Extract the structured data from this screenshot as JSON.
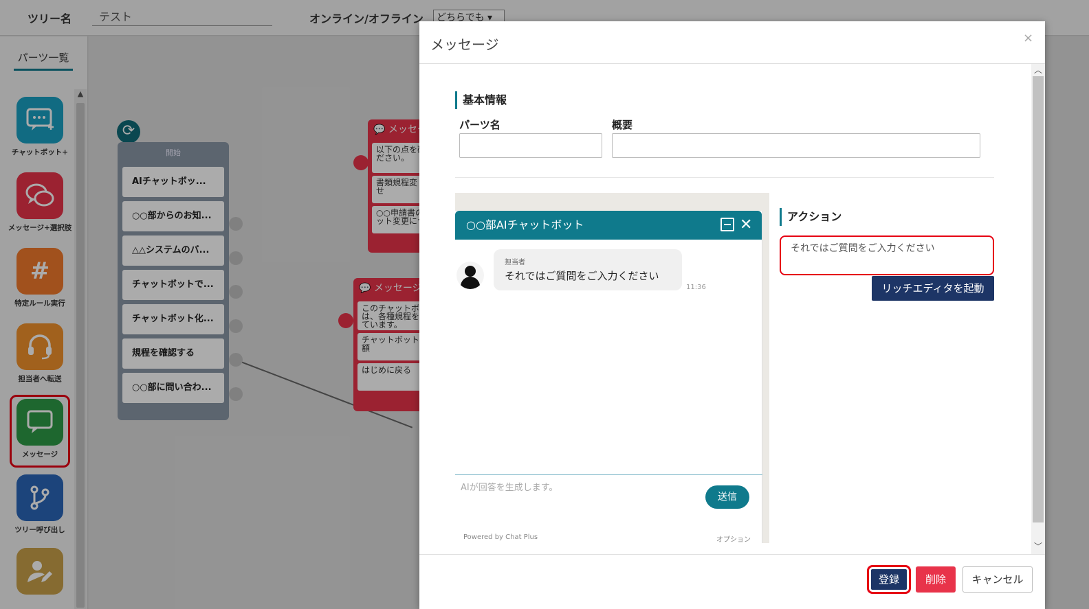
{
  "header": {
    "tree_label": "ツリー名",
    "tree_name_value": "テスト",
    "online_label": "オンライン/オフライン",
    "online_select_value": "どちらでも"
  },
  "sidebar": {
    "parts_tab": "パーツ一覧",
    "parts": [
      {
        "label": "チャットボット+",
        "icon": "chatbot-plus-icon",
        "color": "#1aa0c2"
      },
      {
        "label": "メッセージ+選択肢",
        "icon": "message-choice-icon",
        "color": "#e8334a"
      },
      {
        "label": "特定ルール実行",
        "icon": "hash-icon",
        "color": "#f07a2c"
      },
      {
        "label": "担当者へ転送",
        "icon": "headset-icon",
        "color": "#f0912c"
      },
      {
        "label": "メッセージ",
        "icon": "message-icon",
        "color": "#2e9a46"
      },
      {
        "label": "ツリー呼び出し",
        "icon": "branch-icon",
        "color": "#2a66b8"
      },
      {
        "label": "",
        "icon": "user-edit-icon",
        "color": "#c8a04a"
      }
    ]
  },
  "canvas": {
    "start_node": {
      "title": "開始",
      "items": [
        "AIチャットボッ...",
        "○○部からのお知...",
        "△△システムのバ...",
        "チャットボットで...",
        "チャットボット化...",
        "規程を確認する",
        "○○部に問い合わ..."
      ]
    },
    "msg_node_1": {
      "title": "メッセー",
      "items": [
        "以下の点を確\nださい。",
        "書類規程変\nせ",
        "○○申請書の\nット変更につ"
      ]
    },
    "msg_node_2": {
      "title": "メッセージ",
      "items": [
        "このチャットボ\nは、各種規程を\nています。",
        "チャットボット\n額",
        "はじめに戻る"
      ]
    }
  },
  "modal": {
    "title": "メッセージ",
    "close": "×",
    "basic_info": "基本情報",
    "part_name_label": "パーツ名",
    "part_name_value": "",
    "summary_label": "概要",
    "summary_value": "",
    "preview": {
      "header_title": "○○部AIチャットボット",
      "sender": "担当者",
      "message": "それではご質問をご入力ください",
      "time": "11:36",
      "input_placeholder": "AIが回答を生成します。",
      "send_label": "送信",
      "powered_by": "Powered by Chat Plus",
      "option_label": "オプション"
    },
    "action_label": "アクション",
    "action_text": "それではご質問をご入力ください",
    "rich_editor_button": "リッチエディタを起動",
    "footer": {
      "register": "登録",
      "delete": "削除",
      "cancel": "キャンセル"
    }
  }
}
